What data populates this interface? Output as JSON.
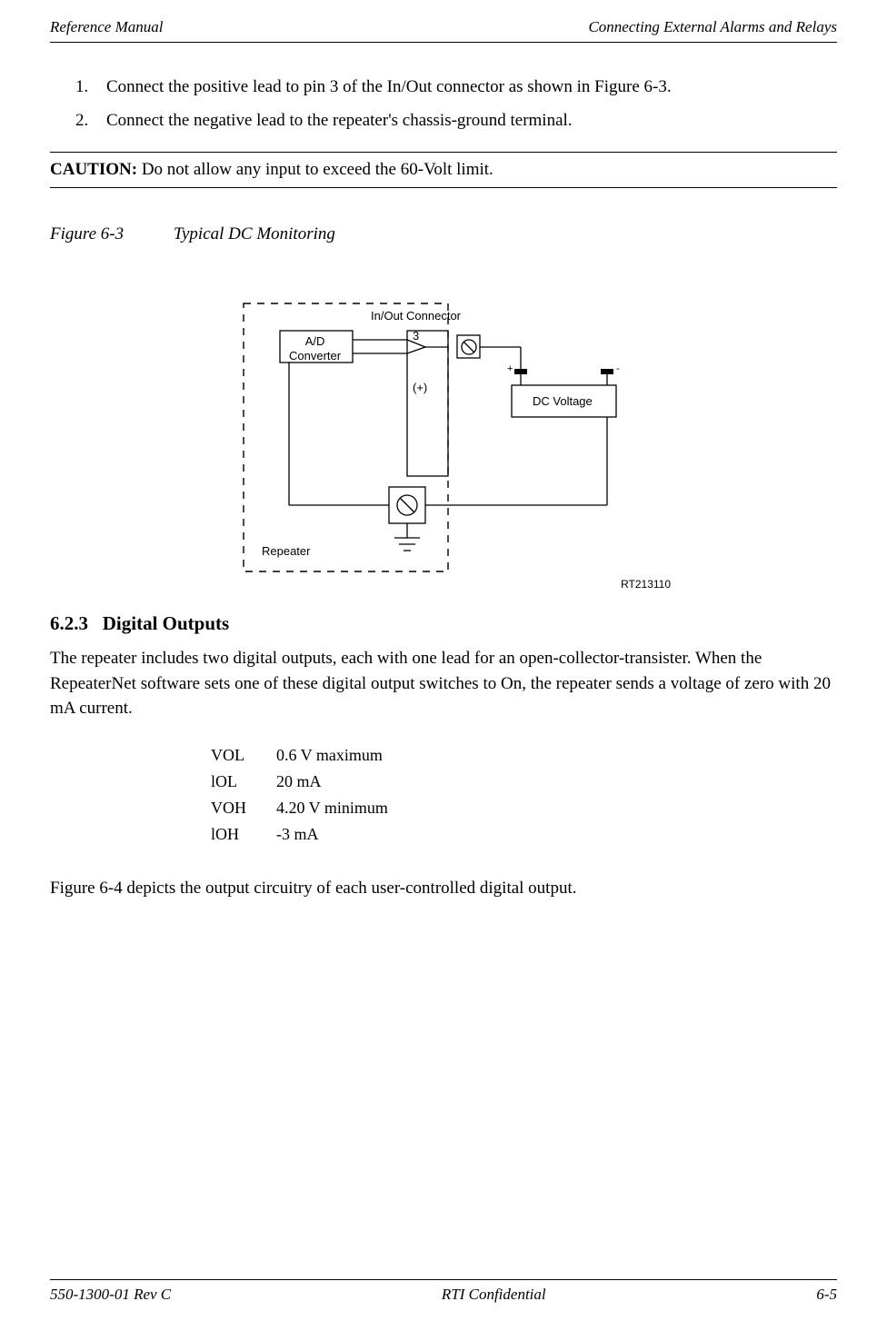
{
  "header": {
    "left": "Reference Manual",
    "right": "Connecting External Alarms and Relays"
  },
  "steps": [
    {
      "num": "1.",
      "text": "Connect the positive lead to pin 3 of the In/Out connector as shown in Figure 6-3."
    },
    {
      "num": "2.",
      "text": "Connect the negative lead to the repeater's chassis-ground terminal."
    }
  ],
  "caution": {
    "label": "CAUTION:",
    "text": "  Do not allow any input to exceed the 60-Volt limit."
  },
  "figure": {
    "num": "Figure 6-3",
    "title": "Typical DC Monitoring"
  },
  "chart_data": {
    "type": "diagram",
    "title": "Typical DC Monitoring",
    "labels": {
      "connector": "In/Out Connector",
      "converter": "A/D\nConverter",
      "pin": "3",
      "polarity_pin": "(+)",
      "dc_voltage": "DC Voltage",
      "plus": "+",
      "minus": "-",
      "repeater": "Repeater",
      "figid": "RT213110"
    }
  },
  "section": {
    "num": "6.2.3",
    "title": "Digital Outputs"
  },
  "body_para": "The repeater includes two digital outputs, each with one lead for an open-collector-transister. When the RepeaterNet software sets one of these digital output switches to On, the repeater sends a voltage of zero with 20 mA current.",
  "specs": [
    {
      "label": "VOL",
      "value": "0.6 V maximum"
    },
    {
      "label": "lOL",
      "value": "20 mA"
    },
    {
      "label": "VOH",
      "value": "4.20 V minimum"
    },
    {
      "label": "lOH",
      "value": "-3 mA"
    }
  ],
  "closing_para": "Figure 6-4 depicts the output circuitry of each user-controlled digital output.",
  "footer": {
    "left": "550-1300-01 Rev C",
    "center": "RTI Confidential",
    "right": "6-5"
  }
}
